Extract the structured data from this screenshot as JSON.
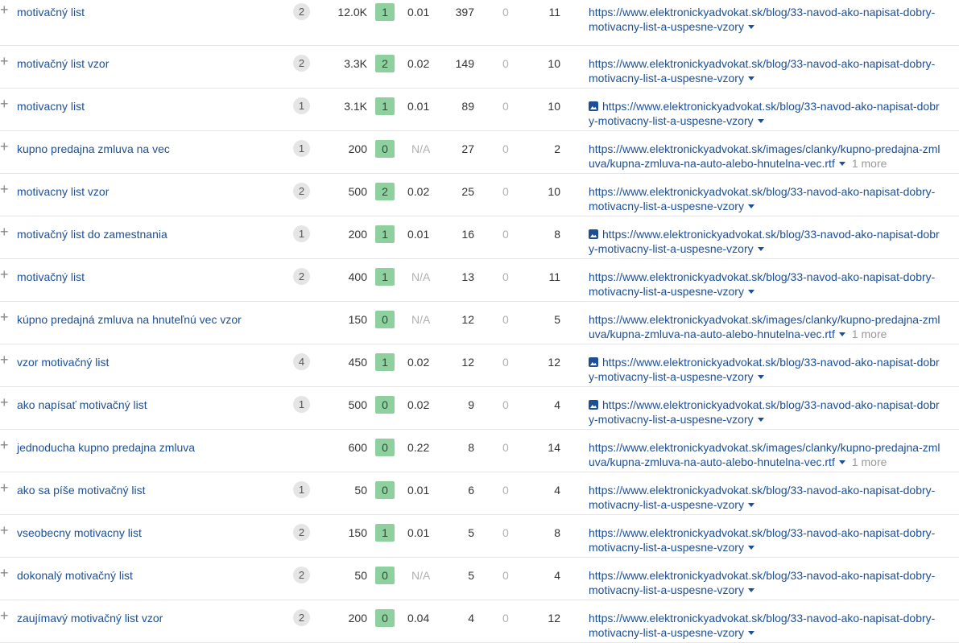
{
  "rows": [
    {
      "keyword": "motivačný list",
      "sf": "2",
      "volume": "12.0K",
      "kd": "1",
      "cpc": "0.01",
      "traffic": "397",
      "zero": "0",
      "position": "11",
      "url_line1": "https://www.elektronickyadvokat.sk/blog/33-navod-ako-napisat-dobry-",
      "url_line2": "motivacny-list-a-uspesne-vzory",
      "image": false,
      "more": ""
    },
    {
      "keyword": "motivačný list vzor",
      "sf": "2",
      "volume": "3.3K",
      "kd": "2",
      "cpc": "0.02",
      "traffic": "149",
      "zero": "0",
      "position": "10",
      "url_line1": "https://www.elektronickyadvokat.sk/blog/33-navod-ako-napisat-dobry-",
      "url_line2": "motivacny-list-a-uspesne-vzory",
      "image": false,
      "more": ""
    },
    {
      "keyword": "motivacny list",
      "sf": "1",
      "volume": "3.1K",
      "kd": "1",
      "cpc": "0.01",
      "traffic": "89",
      "zero": "0",
      "position": "10",
      "url_line1": "https://www.elektronickyadvokat.sk/blog/33-navod-ako-napisat-dobr",
      "url_line2": "y-motivacny-list-a-uspesne-vzory",
      "image": true,
      "more": ""
    },
    {
      "keyword": "kupno predajna zmluva na vec",
      "sf": "1",
      "volume": "200",
      "kd": "0",
      "cpc": "N/A",
      "traffic": "27",
      "zero": "0",
      "position": "2",
      "url_line1": "https://www.elektronickyadvokat.sk/images/clanky/kupno-predajna-zml",
      "url_line2": "uva/kupna-zmluva-na-auto-alebo-hnutelna-vec.rtf",
      "image": false,
      "more": "1 more"
    },
    {
      "keyword": "motivacny list vzor",
      "sf": "2",
      "volume": "500",
      "kd": "2",
      "cpc": "0.02",
      "traffic": "25",
      "zero": "0",
      "position": "10",
      "url_line1": "https://www.elektronickyadvokat.sk/blog/33-navod-ako-napisat-dobry-",
      "url_line2": "motivacny-list-a-uspesne-vzory",
      "image": false,
      "more": ""
    },
    {
      "keyword": "motivačný list do zamestnania",
      "sf": "1",
      "volume": "200",
      "kd": "1",
      "cpc": "0.01",
      "traffic": "16",
      "zero": "0",
      "position": "8",
      "url_line1": "https://www.elektronickyadvokat.sk/blog/33-navod-ako-napisat-dobr",
      "url_line2": "y-motivacny-list-a-uspesne-vzory",
      "image": true,
      "more": ""
    },
    {
      "keyword": "motivačný list",
      "sf": "2",
      "volume": "400",
      "kd": "1",
      "cpc": "N/A",
      "traffic": "13",
      "zero": "0",
      "position": "11",
      "url_line1": "https://www.elektronickyadvokat.sk/blog/33-navod-ako-napisat-dobry-",
      "url_line2": "motivacny-list-a-uspesne-vzory",
      "image": false,
      "more": ""
    },
    {
      "keyword": "kúpno predajná zmluva na hnuteľnú vec vzor",
      "sf": "",
      "volume": "150",
      "kd": "0",
      "cpc": "N/A",
      "traffic": "12",
      "zero": "0",
      "position": "5",
      "url_line1": "https://www.elektronickyadvokat.sk/images/clanky/kupno-predajna-zml",
      "url_line2": "uva/kupna-zmluva-na-auto-alebo-hnutelna-vec.rtf",
      "image": false,
      "more": "1 more"
    },
    {
      "keyword": "vzor motivačný list",
      "sf": "4",
      "volume": "450",
      "kd": "1",
      "cpc": "0.02",
      "traffic": "12",
      "zero": "0",
      "position": "12",
      "url_line1": "https://www.elektronickyadvokat.sk/blog/33-navod-ako-napisat-dobr",
      "url_line2": "y-motivacny-list-a-uspesne-vzory",
      "image": true,
      "more": ""
    },
    {
      "keyword": "ako napísať motivačný list",
      "sf": "1",
      "volume": "500",
      "kd": "0",
      "cpc": "0.02",
      "traffic": "9",
      "zero": "0",
      "position": "4",
      "url_line1": "https://www.elektronickyadvokat.sk/blog/33-navod-ako-napisat-dobr",
      "url_line2": "y-motivacny-list-a-uspesne-vzory",
      "image": true,
      "more": ""
    },
    {
      "keyword": "jednoducha kupno predajna zmluva",
      "sf": "",
      "volume": "600",
      "kd": "0",
      "cpc": "0.22",
      "traffic": "8",
      "zero": "0",
      "position": "14",
      "url_line1": "https://www.elektronickyadvokat.sk/images/clanky/kupno-predajna-zml",
      "url_line2": "uva/kupna-zmluva-na-auto-alebo-hnutelna-vec.rtf",
      "image": false,
      "more": "1 more"
    },
    {
      "keyword": "ako sa píše motivačný list",
      "sf": "1",
      "volume": "50",
      "kd": "0",
      "cpc": "0.01",
      "traffic": "6",
      "zero": "0",
      "position": "4",
      "url_line1": "https://www.elektronickyadvokat.sk/blog/33-navod-ako-napisat-dobry-",
      "url_line2": "motivacny-list-a-uspesne-vzory",
      "image": false,
      "more": ""
    },
    {
      "keyword": "vseobecny motivacny list",
      "sf": "2",
      "volume": "150",
      "kd": "1",
      "cpc": "0.01",
      "traffic": "5",
      "zero": "0",
      "position": "8",
      "url_line1": "https://www.elektronickyadvokat.sk/blog/33-navod-ako-napisat-dobry-",
      "url_line2": "motivacny-list-a-uspesne-vzory",
      "image": false,
      "more": ""
    },
    {
      "keyword": "dokonalý motivačný list",
      "sf": "2",
      "volume": "50",
      "kd": "0",
      "cpc": "N/A",
      "traffic": "5",
      "zero": "0",
      "position": "4",
      "url_line1": "https://www.elektronickyadvokat.sk/blog/33-navod-ako-napisat-dobry-",
      "url_line2": "motivacny-list-a-uspesne-vzory",
      "image": false,
      "more": ""
    },
    {
      "keyword": "zaujímavý motivačný list vzor",
      "sf": "2",
      "volume": "200",
      "kd": "0",
      "cpc": "0.04",
      "traffic": "4",
      "zero": "0",
      "position": "12",
      "url_line1": "https://www.elektronickyadvokat.sk/blog/33-navod-ako-napisat-dobry-",
      "url_line2": "motivacny-list-a-uspesne-vzory",
      "image": false,
      "more": ""
    }
  ],
  "icons": {
    "expand": "plus-icon",
    "image": "image-icon",
    "dropdown": "caret-down-icon"
  },
  "colors": {
    "link": "#1c4f96",
    "kd_badge": "#8fd19e",
    "muted": "#b0b0b0"
  }
}
